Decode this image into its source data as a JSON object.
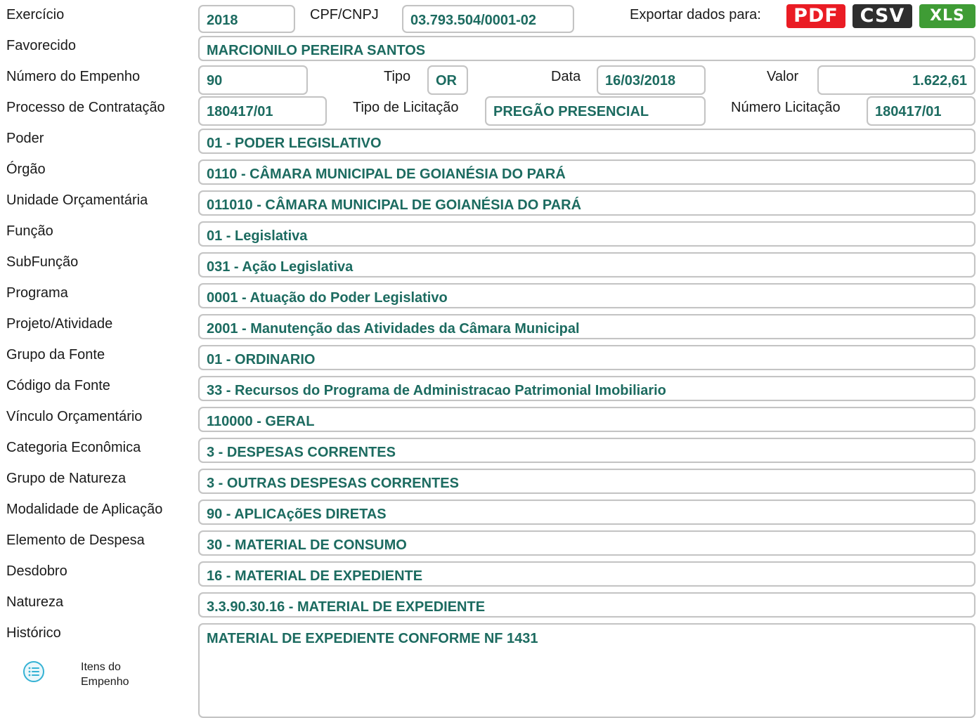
{
  "header": {
    "exercicio_label": "Exercício",
    "exercicio": "2018",
    "cpf_label": "CPF/CNPJ",
    "cpf": "03.793.504/0001-02",
    "export_label": "Exportar dados para:",
    "export_pdf": "PDF",
    "export_csv": "CSV",
    "export_xls": "XLS",
    "colors": {
      "pdf": "#ea1c24",
      "csv": "#2e2e2e",
      "xls": "#3f9c35"
    }
  },
  "favorecido": {
    "label": "Favorecido",
    "value": "MARCIONILO PEREIRA SANTOS"
  },
  "empenho": {
    "numero_label": "Número do Empenho",
    "numero": "90",
    "tipo_label": "Tipo",
    "tipo": "OR",
    "data_label": "Data",
    "data": "16/03/2018",
    "valor_label": "Valor",
    "valor": "1.622,61"
  },
  "processo": {
    "label": "Processo de Contratação",
    "value": "180417/01",
    "tipo_lic_label": "Tipo de Licitação",
    "tipo_lic": "PREGÃO PRESENCIAL",
    "num_lic_label": "Número Licitação",
    "num_lic": "180417/01"
  },
  "fields": [
    {
      "label": "Poder",
      "value": "01 - PODER LEGISLATIVO"
    },
    {
      "label": "Órgão",
      "value": "0110 - CÂMARA MUNICIPAL DE GOIANÉSIA DO PARÁ"
    },
    {
      "label": "Unidade Orçamentária",
      "value": "011010 - CÂMARA MUNICIPAL DE GOIANÉSIA DO PARÁ"
    },
    {
      "label": "Função",
      "value": "01 - Legislativa"
    },
    {
      "label": "SubFunção",
      "value": "031 - Ação Legislativa"
    },
    {
      "label": "Programa",
      "value": "0001 - Atuação do Poder Legislativo"
    },
    {
      "label": "Projeto/Atividade",
      "value": "2001 - Manutenção das Atividades da Câmara Municipal"
    },
    {
      "label": "Grupo da Fonte",
      "value": "01 - ORDINARIO"
    },
    {
      "label": "Código da Fonte",
      "value": "33 - Recursos do Programa de Administracao Patrimonial Imobiliario"
    },
    {
      "label": "Vínculo Orçamentário",
      "value": "110000 - GERAL"
    },
    {
      "label": "Categoria Econômica",
      "value": "3 - DESPESAS CORRENTES"
    },
    {
      "label": "Grupo de Natureza",
      "value": "3 - OUTRAS DESPESAS CORRENTES"
    },
    {
      "label": "Modalidade de Aplicação",
      "value": "90 - APLICAçõES DIRETAS"
    },
    {
      "label": "Elemento de Despesa",
      "value": "30 - MATERIAL DE CONSUMO"
    },
    {
      "label": "Desdobro",
      "value": "16 - MATERIAL DE EXPEDIENTE"
    },
    {
      "label": "Natureza",
      "value": "3.3.90.30.16 - MATERIAL DE EXPEDIENTE"
    }
  ],
  "historico": {
    "label": "Histórico",
    "value": "MATERIAL DE EXPEDIENTE CONFORME NF 1431"
  },
  "itens": {
    "label_line1": "Itens do",
    "label_line2": "Empenho",
    "icon": "list-icon"
  }
}
